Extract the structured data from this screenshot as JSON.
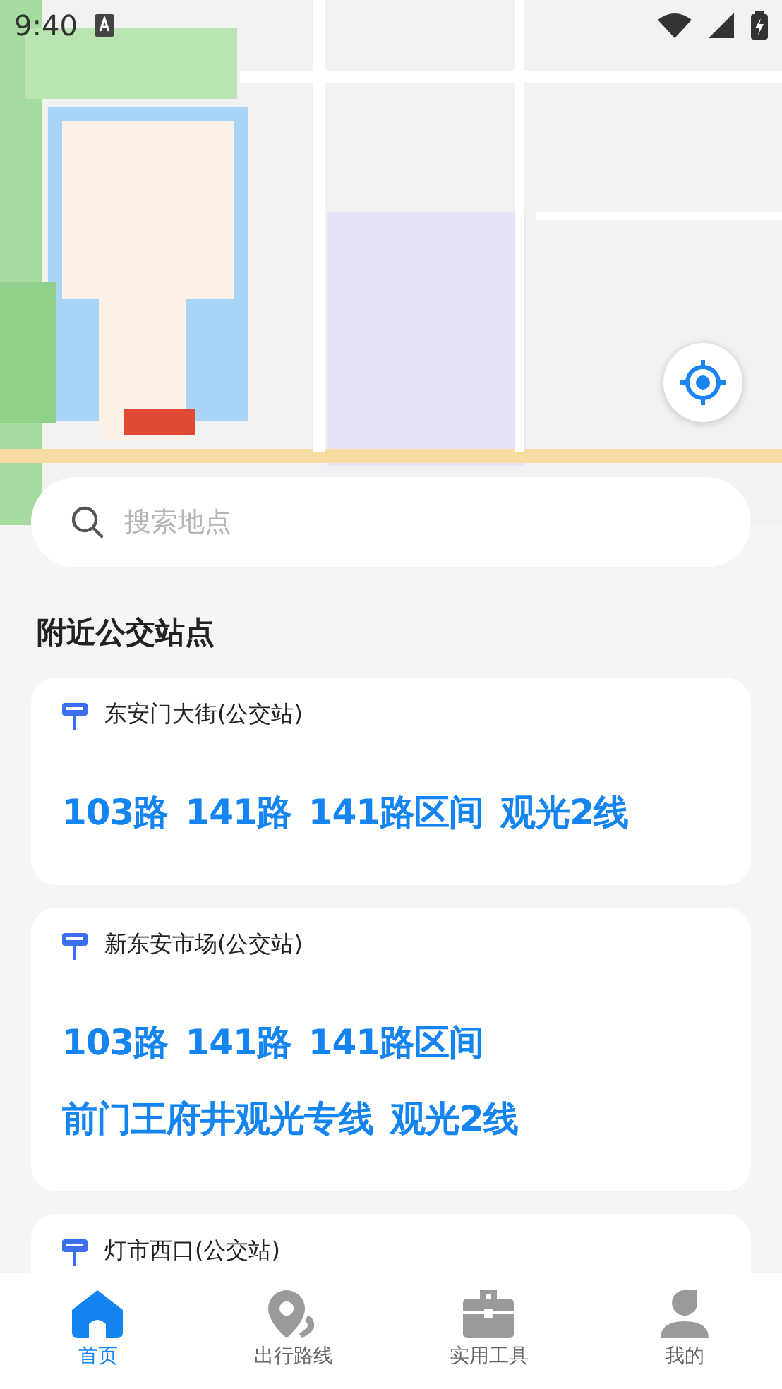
{
  "status_bar": {
    "time": "9:40"
  },
  "search": {
    "placeholder": "搜索地点"
  },
  "section_title": "附近公交站点",
  "stations": [
    {
      "name": "东安门大街(公交站)",
      "routes": [
        "103路",
        "141路",
        "141路区间",
        "观光2线"
      ]
    },
    {
      "name": "新东安市场(公交站)",
      "routes": [
        "103路",
        "141路",
        "141路区间",
        "前门王府井观光专线",
        "观光2线"
      ]
    },
    {
      "name": "灯市西口(公交站)"
    }
  ],
  "tabs": [
    {
      "label": "首页",
      "kind": "home",
      "selected": true
    },
    {
      "label": "出行路线",
      "kind": "route",
      "selected": false
    },
    {
      "label": "实用工具",
      "kind": "tools",
      "selected": false
    },
    {
      "label": "我的",
      "kind": "profile",
      "selected": false
    }
  ]
}
